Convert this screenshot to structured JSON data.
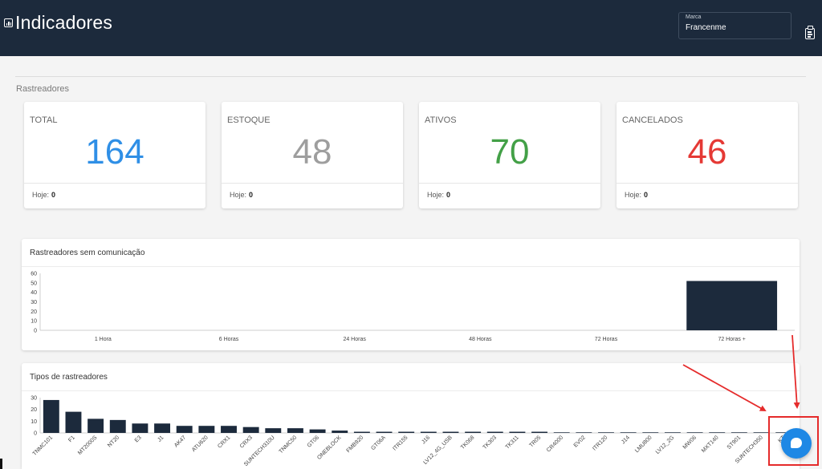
{
  "header": {
    "title": "Indicadores",
    "brand_field": {
      "label": "Marca",
      "value": "Francenme"
    }
  },
  "section": {
    "title": "Rastreadores"
  },
  "stats": [
    {
      "label": "TOTAL",
      "value": "164",
      "color": "#2f8fe6",
      "today_label": "Hoje:",
      "today_value": "0"
    },
    {
      "label": "ESTOQUE",
      "value": "48",
      "color": "#9e9e9e",
      "today_label": "Hoje:",
      "today_value": "0"
    },
    {
      "label": "ATIVOS",
      "value": "70",
      "color": "#43a047",
      "today_label": "Hoje:",
      "today_value": "0"
    },
    {
      "label": "CANCELADOS",
      "value": "46",
      "color": "#e53935",
      "today_label": "Hoje:",
      "today_value": "0"
    }
  ],
  "chart_data": [
    {
      "type": "bar",
      "title": "Rastreadores sem comunicação",
      "categories": [
        "1 Hora",
        "6 Horas",
        "24 Horas",
        "48 Horas",
        "72 Horas",
        "72 Horas +"
      ],
      "values": [
        0,
        0,
        0,
        0,
        0,
        52
      ],
      "ylim": [
        0,
        60
      ],
      "yticks": [
        0,
        10,
        20,
        30,
        40,
        50,
        60
      ],
      "color": "#1c2a3c",
      "grid": false
    },
    {
      "type": "bar",
      "title": "Tipos de rastreadores",
      "categories": [
        "TNMC101",
        "F1",
        "MT2000S",
        "NT20",
        "E3",
        "J1",
        "AK47",
        "ATU620",
        "CRX1",
        "CRX3",
        "SUNTECH310U",
        "TNMC50",
        "GT06",
        "ONEBLOCK",
        "FMB920",
        "GT06A",
        "ITR155",
        "J16",
        "LV12_4G_USB",
        "TK068",
        "TK303",
        "TK311",
        "TR05",
        "CR4000",
        "EV02",
        "ITR120",
        "J14",
        "LMU800",
        "LV12_2G",
        "MW06",
        "MXT140",
        "ST901",
        "SUNTECH350",
        "KT"
      ],
      "values": [
        28,
        18,
        12,
        11,
        8,
        8,
        6,
        6,
        6,
        5,
        4,
        4,
        3,
        2,
        1,
        1,
        1,
        1,
        1,
        1,
        1,
        1,
        1,
        0.5,
        0.5,
        0.5,
        0.5,
        0.5,
        0.5,
        0.5,
        0.5,
        0.5,
        0.5,
        0.5
      ],
      "ylim": [
        0,
        30
      ],
      "yticks": [
        0,
        10,
        20,
        30
      ],
      "color": "#1c2a3c",
      "grid": false
    }
  ]
}
